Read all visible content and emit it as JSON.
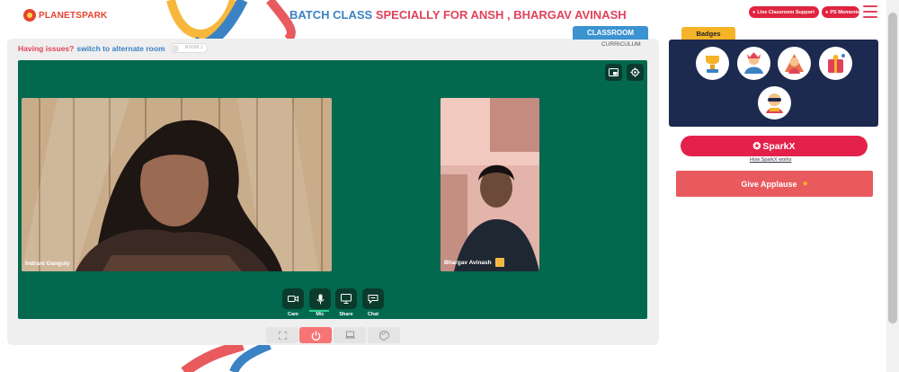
{
  "brand": {
    "logo_text": "PLANETSPARK"
  },
  "header": {
    "title_part1": "BATCH CLASS",
    "title_part2": "SPECIALLY FOR ANSH , BHARGAV AVINASH",
    "live_support_label": "Live Classroom Support",
    "moments_label": "PS Moments"
  },
  "room": {
    "issue_prefix": "Having issues?",
    "issue_link": "switch to alternate room",
    "toggle_label": "ROOM 1"
  },
  "tabs": {
    "classroom": "CLASSROOM",
    "curriculum": "CURRICULUM"
  },
  "participants": [
    {
      "name": "Indrani Ganguly"
    },
    {
      "name": "Bhargav Avinash"
    }
  ],
  "controls": {
    "cam": "Cam",
    "mic": "Mic",
    "share": "Share",
    "chat": "Chat"
  },
  "right_panel": {
    "badges_title": "Badges",
    "sparkx_label": "SparkX",
    "sparkx_link": "How SparkX works",
    "applause_label": "Give Applause"
  },
  "colors": {
    "accent_red": "#e0425b",
    "accent_blue": "#3b82c4",
    "stage_green": "#02694f",
    "badges_bg": "#1c2a4f"
  }
}
